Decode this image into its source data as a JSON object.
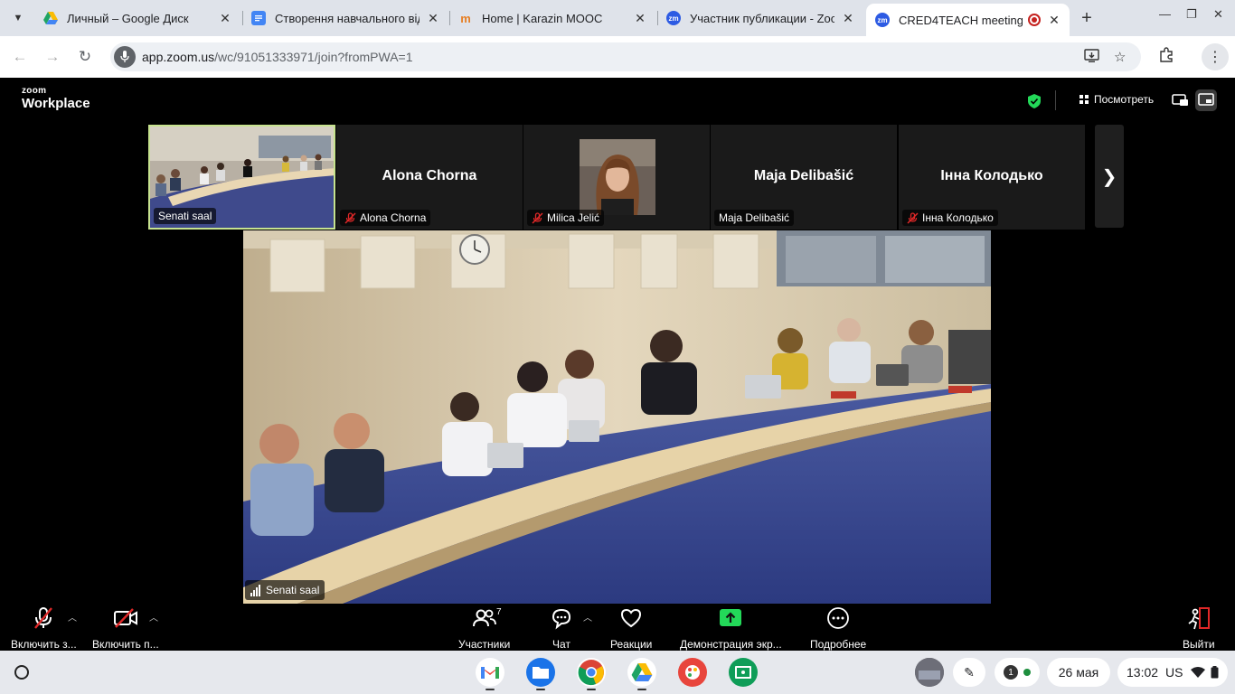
{
  "browser": {
    "tabs": [
      {
        "title": "Личный – Google Диск",
        "icon": "google-drive-icon",
        "color": "#1fa463"
      },
      {
        "title": "Створення навчального від",
        "icon": "google-docs-icon",
        "color": "#4285f4"
      },
      {
        "title": "Home | Karazin MOOC",
        "icon": "karazin-mooc-icon",
        "color": "#e67e22"
      },
      {
        "title": "Участник публикации - Zoo",
        "icon": "zoom-icon",
        "color": "#2d8cff"
      },
      {
        "title": "CRED4TEACH meeting",
        "icon": "zoom-icon",
        "color": "#2d8cff",
        "active": true
      }
    ],
    "url_host": "app.zoom.us",
    "url_path": "/wc/91051333971/join?fromPWA=1"
  },
  "zoom": {
    "logo_small": "zoom",
    "logo_big": "Workplace",
    "view_label": "Посмотреть",
    "security_color": "#23d959",
    "filmstrip": [
      {
        "label": "Senati saal",
        "type": "video",
        "muted": false,
        "speaking": true
      },
      {
        "name": "Alona Chorna",
        "label": "Alona Chorna",
        "type": "name",
        "muted": true
      },
      {
        "label": "Milica Jelić",
        "type": "photo",
        "muted": true
      },
      {
        "name": "Maja Delibašić",
        "label": "Maja Delibašić",
        "type": "name",
        "muted": false
      },
      {
        "name": "Інна Колодько",
        "label": "Інна Колодько",
        "type": "name",
        "muted": true
      }
    ],
    "main_video_label": "Senati saal",
    "controls": {
      "mic": "Включить з...",
      "video": "Включить п...",
      "participants": "Участники",
      "participants_count": "7",
      "chat": "Чат",
      "reactions": "Реакции",
      "share": "Демонстрация экр...",
      "more": "Подробнее",
      "leave": "Выйти"
    }
  },
  "shelf": {
    "date": "26 мая",
    "time": "13:02",
    "locale": "US",
    "notifications": "1",
    "apps": [
      "gmail-icon",
      "files-icon",
      "chrome-icon",
      "google-drive-icon",
      "canvas-icon",
      "classroom-icon"
    ]
  }
}
